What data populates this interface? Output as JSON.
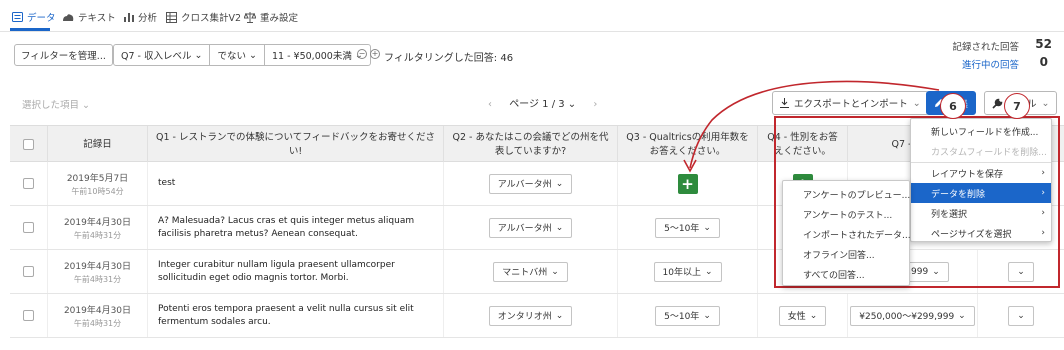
{
  "nav": {
    "tabs": [
      {
        "label": "データ",
        "icon": "data-list-icon"
      },
      {
        "label": "テキスト",
        "icon": "text-cloud-icon"
      },
      {
        "label": "分析",
        "icon": "bar-chart-icon"
      },
      {
        "label": "クロス集計V2",
        "icon": "crosstab-icon"
      },
      {
        "label": "重み設定",
        "icon": "scale-icon"
      }
    ]
  },
  "filters": {
    "manage_label": "フィルターを管理...",
    "field": "Q7 - 収入レベル",
    "operator": "でない",
    "value": "11 - ¥50,000未満",
    "summary": "フィルタリングした回答: 46"
  },
  "counts": {
    "recorded_label": "記録された回答",
    "recorded_value": "52",
    "in_progress_label": "進行中の回答",
    "in_progress_value": "0"
  },
  "toolbar": {
    "selected_items": "選択した項目",
    "page_label": "ページ 1 / 3",
    "export_label": "エクスポートとインポート",
    "edit_label": "編集",
    "tools_label": "ツール"
  },
  "table": {
    "headers": [
      "記録日",
      "Q1 - レストランでの体験についてフィードバックをお寄せください!",
      "Q2 - あなたはこの会議でどの州を代表していますか?",
      "Q3 - Qualtricsの利用年数をお答えください。",
      "Q4 - 性別をお答えください。",
      "Q7 - 収入"
    ],
    "rows": [
      {
        "date": "2019年5月7日",
        "time": "午前10時54分",
        "q1": "test",
        "q2": "アルバータ州",
        "q3": "",
        "q4": "",
        "q7": ""
      },
      {
        "date": "2019年4月30日",
        "time": "午前4時31分",
        "q1": "A? Malesuada? Lacus cras et quis integer metus aliquam facilisis pharetra metus? Aenean consequat.",
        "q2": "アルバータ州",
        "q3": "5〜10年",
        "q4": "",
        "q7": ""
      },
      {
        "date": "2019年4月30日",
        "time": "午前4時31分",
        "q1": "Integer curabitur nullam ligula praesent ullamcorper sollicitudin eget odio magnis tortor. Morbi.",
        "q2": "マニトバ州",
        "q3": "10年以上",
        "q4": "",
        "q7": "¥149,999"
      },
      {
        "date": "2019年4月30日",
        "time": "午前4時31分",
        "q1": "Potenti eros tempora praesent a velit nulla cursus sit elit fermentum sodales arcu.",
        "q2": "オンタリオ州",
        "q3": "5〜10年",
        "q4": "女性",
        "q7": "¥250,000〜¥299,999"
      }
    ]
  },
  "tools_menu": {
    "items": [
      {
        "label": "新しいフィールドを作成...",
        "state": "normal"
      },
      {
        "label": "カスタムフィールドを削除...",
        "state": "disabled"
      },
      {
        "label": "レイアウトを保存",
        "state": "normal",
        "submenu": true
      },
      {
        "label": "データを削除",
        "state": "highlighted",
        "submenu": true
      },
      {
        "label": "列を選択",
        "state": "normal",
        "submenu": true
      },
      {
        "label": "ページサイズを選択",
        "state": "normal",
        "submenu": true
      }
    ]
  },
  "delete_submenu": {
    "items": [
      "アンケートのプレビュー...",
      "アンケートのテスト...",
      "インポートされたデータ...",
      "オフライン回答...",
      "すべての回答..."
    ]
  },
  "annotations": {
    "step_a": "6",
    "step_b": "7",
    "color": "#c1272d"
  },
  "colors": {
    "accent": "#1b66c9",
    "add_button": "#2e8b3d"
  }
}
